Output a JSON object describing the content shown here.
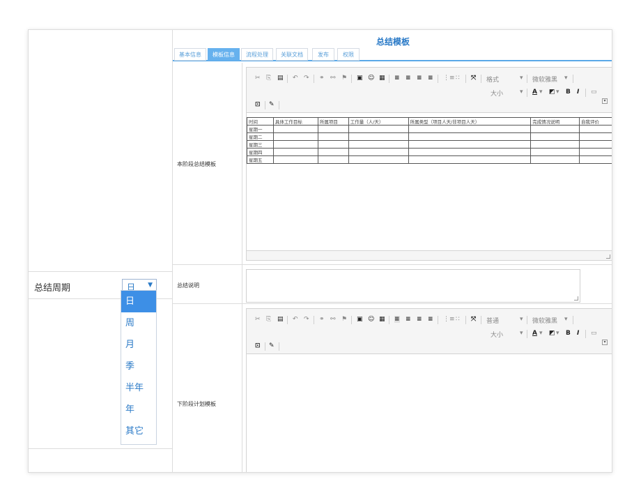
{
  "left_panel": {
    "period_label": "总结周期",
    "period_value": "日",
    "period_options": [
      "日",
      "周",
      "月",
      "季",
      "半年",
      "年",
      "其它"
    ]
  },
  "header": {
    "title": "总结模板"
  },
  "tabs": [
    {
      "label": "基本信息",
      "active": false
    },
    {
      "label": "模板信息",
      "active": true
    },
    {
      "label": "流程处理",
      "active": false
    },
    {
      "label": "关联文档",
      "active": false
    },
    {
      "label": "发布",
      "active": false
    },
    {
      "label": "权限",
      "active": false
    }
  ],
  "rows": {
    "current_summary_label": "本阶段总结模板",
    "summary_note_label": "总结说明",
    "next_plan_label": "下阶段计划模板"
  },
  "editor1_toolbar": {
    "format_label": "格式",
    "font_label": "微软雅黑",
    "size_label": "大小"
  },
  "editor2_toolbar": {
    "format_label": "普通",
    "font_label": "微软雅黑",
    "size_label": "大小"
  },
  "summary_table": {
    "headers": [
      "时间",
      "具体工作目标",
      "所属项目",
      "工作量（人/天）",
      "所属类型（项目人天/非项目人天）",
      "完成情况说明",
      "自我评价"
    ],
    "rows": [
      "星期一",
      "星期二",
      "星期三",
      "星期四",
      "星期五"
    ]
  },
  "colors": {
    "accent": "#2a7ac7",
    "tab_active": "#66b1ee",
    "dropdown_selected": "#3d8fe6"
  }
}
